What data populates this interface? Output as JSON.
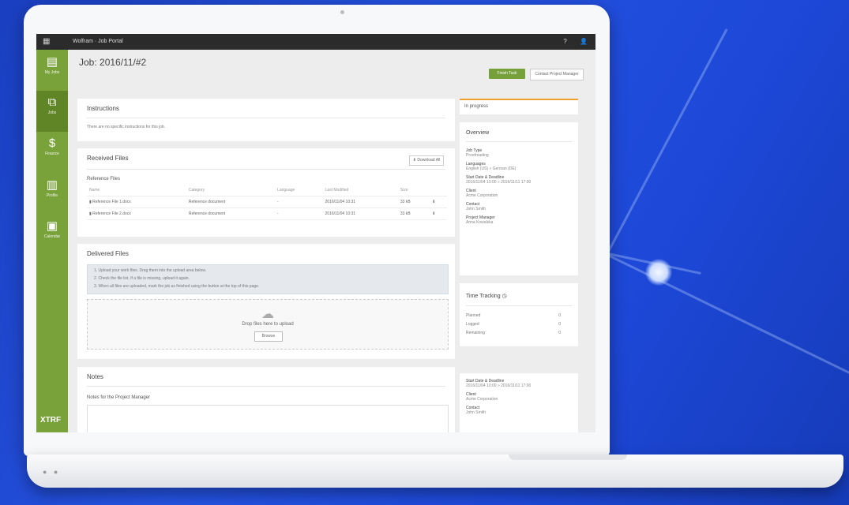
{
  "topbar": {
    "title": "Wolfram · Job Portal",
    "help": "?",
    "user_icon": "user-icon"
  },
  "sidebar": {
    "items": [
      {
        "label": "My Jobs",
        "icon": "document-icon"
      },
      {
        "label": "Jobs",
        "icon": "copy-icon"
      },
      {
        "label": "Finance",
        "icon": "dollar-icon"
      },
      {
        "label": "Profile",
        "icon": "profile-icon"
      },
      {
        "label": "Calendar",
        "icon": "calendar-icon"
      }
    ],
    "logo": "XTRF"
  },
  "page": {
    "title": "Job: 2016/11/#2",
    "primary_button": "Finish Task",
    "secondary_button": "Contact Project Manager"
  },
  "instructions": {
    "title": "Instructions",
    "text": "There are no specific instructions for this job."
  },
  "received": {
    "title": "Received Files",
    "download_all": "Download All",
    "group_label": "Reference Files",
    "columns": [
      "Name",
      "Category",
      "Language",
      "Last Modified",
      "Size",
      ""
    ],
    "rows": [
      {
        "name": "Reference File 1.docx",
        "category": "Reference document",
        "language": "-",
        "modified": "2016/11/04 10:31",
        "size": "33 kB"
      },
      {
        "name": "Reference File 2.docx",
        "category": "Reference document",
        "language": "-",
        "modified": "2016/11/04 10:31",
        "size": "33 kB"
      }
    ]
  },
  "delivered": {
    "title": "Delivered Files",
    "info": [
      "1. Upload your work files. Drag them into the upload area below.",
      "2. Check the file list. If a file is missing, upload it again.",
      "3. When all files are uploaded, mark the job as finished using the button at the top of this page."
    ],
    "drop_text": "Drop files here to upload",
    "browse": "Browse"
  },
  "notes": {
    "title": "Notes",
    "label": "Notes for the Project Manager"
  },
  "right": {
    "status": "In progress",
    "overview_title": "Overview",
    "fields": [
      {
        "label": "Job Type",
        "value": "Proofreading"
      },
      {
        "label": "Languages",
        "value": "English (US) » German (DE)"
      },
      {
        "label": "Start Date & Deadline",
        "value": "2016/11/04 10:00 » 2016/11/11 17:00"
      },
      {
        "label": "Client",
        "value": "Acme Corporation"
      },
      {
        "label": "Contact",
        "value": "John Smith"
      },
      {
        "label": "Project Manager",
        "value": "Anna Kowalska"
      }
    ],
    "tracking_title": "Time Tracking",
    "tracking": [
      {
        "label": "Planned",
        "value": "0"
      },
      {
        "label": "Logged",
        "value": "0"
      },
      {
        "label": "Remaining",
        "value": "0"
      }
    ],
    "second_fields": [
      {
        "label": "Start Date & Deadline",
        "value": "2016/11/04 10:00 » 2016/11/11 17:00"
      },
      {
        "label": "Client",
        "value": "Acme Corporation"
      },
      {
        "label": "Contact",
        "value": "John Smith"
      }
    ]
  }
}
